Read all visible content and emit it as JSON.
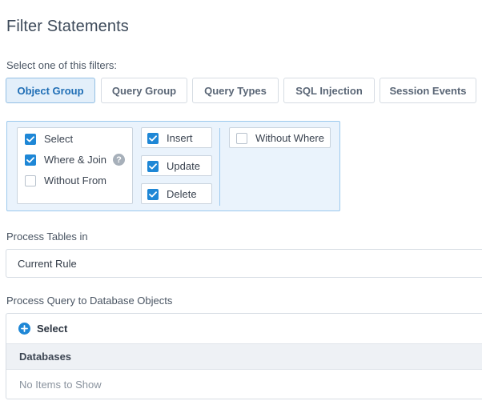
{
  "page": {
    "title": "Filter Statements",
    "filters_label": "Select one of this filters:"
  },
  "tabs": [
    {
      "label": "Object Group",
      "active": true
    },
    {
      "label": "Query Group",
      "active": false
    },
    {
      "label": "Query Types",
      "active": false
    },
    {
      "label": "SQL Injection",
      "active": false
    },
    {
      "label": "Session Events",
      "active": false
    }
  ],
  "filters": {
    "select": {
      "label": "Select",
      "checked": true
    },
    "where_join": {
      "label": "Where & Join",
      "checked": true,
      "help_icon": "question-circle-icon"
    },
    "without_from": {
      "label": "Without From",
      "checked": false
    },
    "insert": {
      "label": "Insert",
      "checked": true
    },
    "update": {
      "label": "Update",
      "checked": true
    },
    "delete": {
      "label": "Delete",
      "checked": true
    },
    "without_where": {
      "label": "Without Where",
      "checked": false
    }
  },
  "process_tables": {
    "label": "Process Tables in",
    "value": "Current Rule"
  },
  "process_query": {
    "label": "Process Query to Database Objects",
    "add_label": "Select",
    "add_icon": "plus-circle-icon",
    "column_header": "Databases",
    "empty_text": "No Items to Show"
  },
  "colors": {
    "accent": "#1e87d6",
    "active_tab_bg": "#e3effa",
    "panel_bg": "#eaf3fc"
  }
}
